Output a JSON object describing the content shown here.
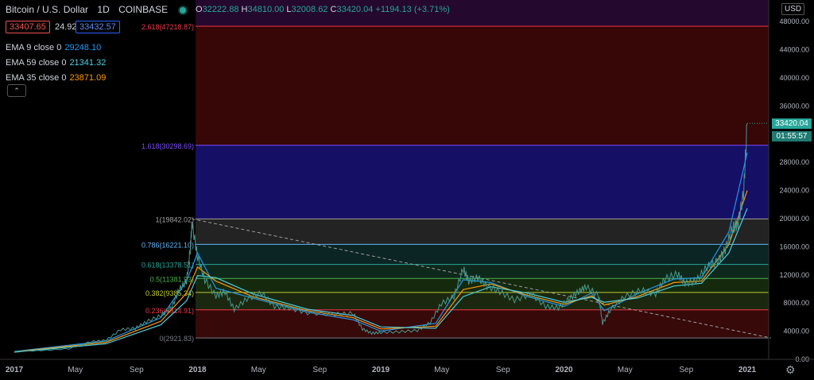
{
  "header": {
    "symbol": "Bitcoin / U.S. Dollar",
    "interval": "1D",
    "exchange": "COINBASE",
    "open_label": "O",
    "open": "32222.88",
    "high_label": "H",
    "high": "34810.00",
    "low_label": "L",
    "low": "32008.62",
    "close_label": "C",
    "close": "33420.04",
    "change": "+1194.13 (+3.71%)",
    "sell_price": "33407.65",
    "spread": "24.92",
    "buy_price": "33432.57"
  },
  "indicators": [
    {
      "label": "EMA 9 close 0",
      "value": "29248.10",
      "color": "#2196f3"
    },
    {
      "label": "EMA 59 close 0",
      "value": "21341.32",
      "color": "#4dd0e1"
    },
    {
      "label": "EMA 35 close 0",
      "value": "23871.09",
      "color": "#ff9800"
    }
  ],
  "price_axis": {
    "currency_button": "USD",
    "last_price": "33420.04",
    "countdown": "01:55:57"
  },
  "chart_data": {
    "type": "line",
    "title": "",
    "xlabel": "",
    "ylabel": "",
    "ylim": [
      0,
      50000
    ],
    "yticks": [
      0,
      4000,
      8000,
      12000,
      16000,
      20000,
      24000,
      28000,
      32000,
      36000,
      40000,
      44000,
      48000
    ],
    "ytick_labels": [
      "0.00",
      "4000.00",
      "8000.00",
      "12000.00",
      "16000.00",
      "20000.00",
      "24000.00",
      "28000.00",
      "32000.00",
      "36000.00",
      "40000.00",
      "44000.00",
      "48000.00"
    ],
    "xticks": [
      {
        "t": 0.0,
        "label": "2017"
      },
      {
        "t": 0.333,
        "label": "May"
      },
      {
        "t": 0.667,
        "label": "Sep"
      },
      {
        "t": 1.0,
        "label": "2018"
      },
      {
        "t": 1.333,
        "label": "May"
      },
      {
        "t": 1.667,
        "label": "Sep"
      },
      {
        "t": 2.0,
        "label": "2019"
      },
      {
        "t": 2.333,
        "label": "May"
      },
      {
        "t": 2.667,
        "label": "Sep"
      },
      {
        "t": 3.0,
        "label": "2020"
      },
      {
        "t": 3.333,
        "label": "May"
      },
      {
        "t": 3.667,
        "label": "Sep"
      },
      {
        "t": 4.0,
        "label": "2021"
      }
    ],
    "x_note": "t = years since start of 2017",
    "fib_levels": [
      {
        "ratio": "0",
        "price": 2921.83,
        "label": "0(2921.83)",
        "color": "#787b86",
        "fill": "#3a0a0a"
      },
      {
        "ratio": "0.236",
        "price": 6914.91,
        "label": "0.236(6914.91)",
        "color": "#f23645",
        "fill": "#1c2a10"
      },
      {
        "ratio": "0.382",
        "price": 9385.34,
        "label": "0.382(9385.34)",
        "color": "#c0ca33",
        "fill": "#162b0e"
      },
      {
        "ratio": "0.5",
        "price": 11381.93,
        "label": "0.5(11381.93)",
        "color": "#4caf50",
        "fill": "#0f2a1c"
      },
      {
        "ratio": "0.618",
        "price": 13378.51,
        "label": "0.618(13378.51)",
        "color": "#26a69a",
        "fill": "#0c2626"
      },
      {
        "ratio": "0.786",
        "price": 16221.1,
        "label": "0.786(16221.10)",
        "color": "#64b5f6",
        "fill": "#252525"
      },
      {
        "ratio": "1",
        "price": 19842.02,
        "label": "1(19842.02)",
        "color": "#a0a0a0",
        "fill": "#16106a"
      },
      {
        "ratio": "1.618",
        "price": 30298.69,
        "label": "1.618(30298.69)",
        "color": "#7c4dff",
        "fill": "#3a0606"
      },
      {
        "ratio": "2.618",
        "price": 47218.87,
        "label": "2.618(47218.87)",
        "color": "#f23645",
        "fill": "#2b0a33"
      }
    ],
    "price_series": {
      "name": "BTCUSD",
      "x": [
        0.0,
        0.15,
        0.3,
        0.42,
        0.5,
        0.58,
        0.66,
        0.72,
        0.8,
        0.86,
        0.9,
        0.94,
        0.96,
        0.97,
        1.0,
        1.04,
        1.1,
        1.15,
        1.2,
        1.27,
        1.35,
        1.42,
        1.5,
        1.6,
        1.75,
        1.85,
        1.9,
        1.95,
        2.0,
        2.1,
        2.2,
        2.27,
        2.33,
        2.4,
        2.45,
        2.48,
        2.53,
        2.58,
        2.65,
        2.73,
        2.82,
        2.9,
        2.97,
        3.03,
        3.08,
        3.12,
        3.19,
        3.21,
        3.25,
        3.33,
        3.42,
        3.5,
        3.55,
        3.62,
        3.66,
        3.72,
        3.78,
        3.84,
        3.88,
        3.92,
        3.95,
        3.98,
        4.0
      ],
      "values": [
        1000,
        1150,
        1400,
        2400,
        2600,
        4100,
        4300,
        5200,
        6100,
        7300,
        9800,
        11000,
        15500,
        19200,
        14500,
        11200,
        8900,
        9500,
        7000,
        8500,
        9300,
        7400,
        7200,
        6500,
        6300,
        6400,
        4200,
        3600,
        3700,
        3800,
        4000,
        5100,
        7800,
        8800,
        12800,
        11000,
        11500,
        10300,
        9500,
        8300,
        9200,
        7400,
        7200,
        8500,
        9500,
        10200,
        8900,
        5000,
        6800,
        8800,
        9700,
        9200,
        11300,
        12000,
        10700,
        11000,
        13000,
        13800,
        15500,
        18500,
        19200,
        23500,
        33420
      ]
    },
    "ema_series": [
      {
        "name": "EMA 9",
        "color": "#2196f3",
        "x": [
          0.0,
          0.5,
          0.8,
          0.94,
          1.0,
          1.1,
          1.3,
          1.6,
          1.85,
          2.0,
          2.3,
          2.45,
          2.6,
          2.8,
          3.0,
          3.15,
          3.22,
          3.4,
          3.6,
          3.75,
          3.9,
          4.0
        ],
        "values": [
          1000,
          2500,
          5800,
          11000,
          15000,
          10000,
          8600,
          6600,
          5500,
          3900,
          5000,
          11200,
          10800,
          8800,
          7400,
          9300,
          6800,
          9200,
          11300,
          11500,
          18000,
          29248
        ]
      },
      {
        "name": "EMA 35",
        "color": "#ff9800",
        "x": [
          0.0,
          0.5,
          0.8,
          0.94,
          1.0,
          1.1,
          1.3,
          1.6,
          1.85,
          2.0,
          2.3,
          2.45,
          2.6,
          2.8,
          3.0,
          3.15,
          3.22,
          3.4,
          3.6,
          3.75,
          3.9,
          4.0
        ],
        "values": [
          950,
          2300,
          5300,
          9300,
          13000,
          11000,
          8800,
          6800,
          5800,
          4200,
          4600,
          9800,
          10600,
          9000,
          7700,
          8900,
          7600,
          8800,
          10800,
          11000,
          16200,
          23871
        ]
      },
      {
        "name": "EMA 59",
        "color": "#4dd0e1",
        "x": [
          0.0,
          0.5,
          0.8,
          0.94,
          1.0,
          1.1,
          1.3,
          1.6,
          1.85,
          2.0,
          2.3,
          2.45,
          2.6,
          2.8,
          3.0,
          3.15,
          3.22,
          3.4,
          3.6,
          3.75,
          3.9,
          4.0
        ],
        "values": [
          900,
          2100,
          4800,
          8200,
          11800,
          11500,
          9200,
          7000,
          6100,
          4500,
          4300,
          8800,
          10200,
          9300,
          8000,
          8700,
          8000,
          8600,
          10300,
          10700,
          15000,
          21341
        ]
      }
    ],
    "trendline": {
      "x": [
        0.97,
        4.13
      ],
      "values": [
        19842,
        2921
      ]
    }
  }
}
